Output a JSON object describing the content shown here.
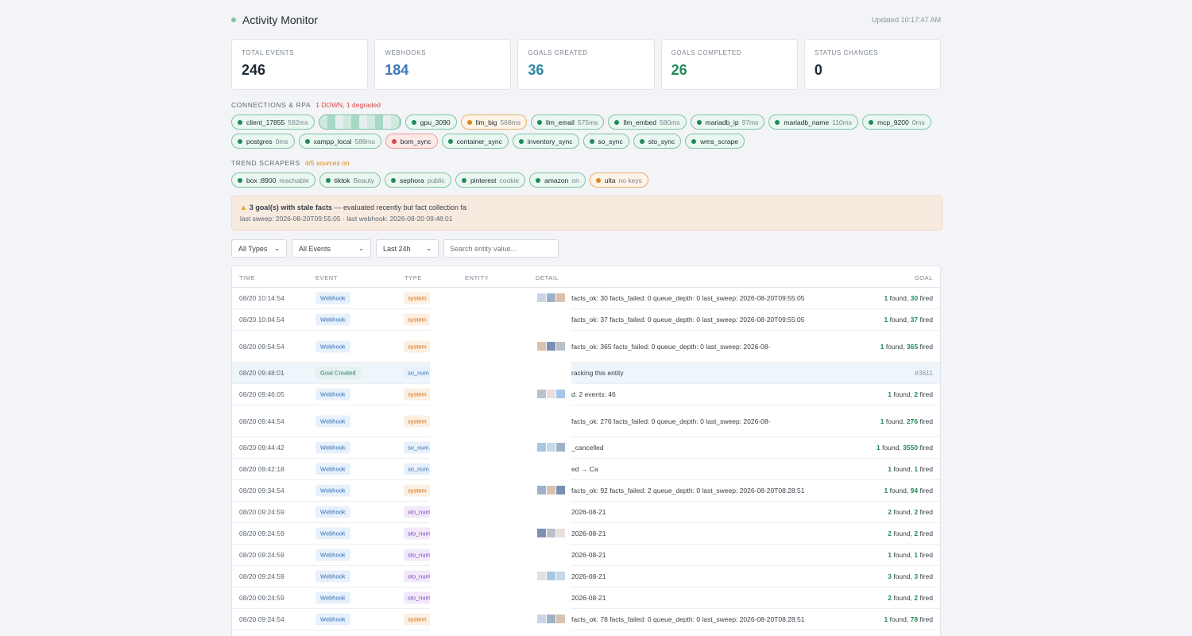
{
  "header": {
    "title": "Activity Monitor",
    "updated": "Updated 10:17:47 AM"
  },
  "stats": [
    {
      "label": "TOTAL EVENTS",
      "value": "246",
      "color": "#1f2933"
    },
    {
      "label": "WEBHOOKS",
      "value": "184",
      "color": "#3b79b8"
    },
    {
      "label": "GOALS CREATED",
      "value": "36",
      "color": "#2a86a3"
    },
    {
      "label": "GOALS COMPLETED",
      "value": "26",
      "color": "#1f8a5b"
    },
    {
      "label": "STATUS CHANGES",
      "value": "0",
      "color": "#1f2933"
    }
  ],
  "connections": {
    "title": "CONNECTIONS & RPA",
    "alert": "1 DOWN, 1 degraded",
    "row1": [
      {
        "name": "client_17855",
        "ms": "592ms",
        "state": "ok"
      },
      {
        "name": "",
        "ms": "",
        "state": "redacted"
      },
      {
        "name": "gpu_3090",
        "ms": "",
        "state": "ok"
      },
      {
        "name": "llm_big",
        "ms": "568ms",
        "state": "warn"
      },
      {
        "name": "llm_email",
        "ms": "575ms",
        "state": "ok"
      },
      {
        "name": "llm_embed",
        "ms": "580ms",
        "state": "ok"
      },
      {
        "name": "mariadb_ip",
        "ms": "97ms",
        "state": "ok"
      },
      {
        "name": "mariadb_name",
        "ms": "110ms",
        "state": "ok"
      },
      {
        "name": "mcp_9200",
        "ms": "0ms",
        "state": "ok"
      }
    ],
    "row2": [
      {
        "name": "postgres",
        "ms": "0ms",
        "state": "ok"
      },
      {
        "name": "xampp_local",
        "ms": "588ms",
        "state": "ok"
      },
      {
        "name": "bom_sync",
        "ms": "",
        "state": "down"
      },
      {
        "name": "container_sync",
        "ms": "",
        "state": "ok"
      },
      {
        "name": "inventory_sync",
        "ms": "",
        "state": "ok"
      },
      {
        "name": "so_sync",
        "ms": "",
        "state": "ok"
      },
      {
        "name": "sto_sync",
        "ms": "",
        "state": "ok"
      },
      {
        "name": "wms_scrape",
        "ms": "",
        "state": "ok"
      }
    ]
  },
  "scrapers": {
    "title": "TREND SCRAPERS",
    "status": "4/5 sources on",
    "items": [
      {
        "name": "box :8900",
        "note": "reachable",
        "state": "ok"
      },
      {
        "name": "tiktok",
        "note": "Beauty",
        "state": "ok"
      },
      {
        "name": "sephora",
        "note": "public",
        "state": "ok"
      },
      {
        "name": "pinterest",
        "note": "cookie",
        "state": "ok"
      },
      {
        "name": "amazon",
        "note": "on",
        "state": "ok"
      },
      {
        "name": "ulta",
        "note": "no keys",
        "state": "warn"
      }
    ]
  },
  "banner": {
    "strong": "3 goal(s) with stale facts",
    "text": " — evaluated recently but fact collection fa",
    "line2": "last sweep: 2026-08-20T09:55:05 · last webhook: 2026-08-20 09:48:01"
  },
  "filters": {
    "types": "All Types",
    "events": "All Events",
    "range": "Last 24h",
    "search_placeholder": "Search entity value..."
  },
  "table": {
    "headers": {
      "time": "TIME",
      "event": "EVENT",
      "type": "TYPE",
      "entity": "ENTITY",
      "detail": "DETAIL",
      "goal": "GOAL"
    },
    "rows": [
      {
        "time": "08/20 10:14:54",
        "event": "Webhook",
        "type": "system",
        "detail": "facts_ok: 30   facts_failed: 0   queue_depth: 0   last_sweep: 2026-08-20T09:55:05",
        "found": "1",
        "fired": "30"
      },
      {
        "time": "08/20 10:04:54",
        "event": "Webhook",
        "type": "system",
        "detail": "facts_ok: 37   facts_failed: 0   queue_depth: 0   last_sweep: 2026-08-20T09:55:05",
        "found": "1",
        "fired": "37"
      },
      {
        "time": "08/20 09:54:54",
        "event": "Webhook",
        "type": "system",
        "detail": "facts_ok: 365   facts_failed: 0   queue_depth: 0   last_sweep: 2026-08-",
        "found": "1",
        "fired": "365"
      },
      {
        "time": "08/20 09:48:01",
        "event": "Goal Created",
        "type": "so_num",
        "detail": "racking this entity",
        "goal_id": "#3611"
      },
      {
        "time": "08/20 09:46:05",
        "event": "Webhook",
        "type": "system",
        "detail": "d: 2   events: 46",
        "found": "1",
        "fired": "2"
      },
      {
        "time": "08/20 09:44:54",
        "event": "Webhook",
        "type": "system",
        "detail": "facts_ok: 276   facts_failed: 0   queue_depth: 0   last_sweep: 2026-08-",
        "found": "1",
        "fired": "276"
      },
      {
        "time": "08/20 09:44:42",
        "event": "Webhook",
        "type": "so_num",
        "detail": "_cancelled",
        "found": "1",
        "fired": "3550"
      },
      {
        "time": "08/20 09:42:18",
        "event": "Webhook",
        "type": "so_num",
        "detail": "ed → Ca",
        "found": "1",
        "fired": "1"
      },
      {
        "time": "08/20 09:34:54",
        "event": "Webhook",
        "type": "system",
        "detail": "facts_ok: 92   facts_failed: 2   queue_depth: 0   last_sweep: 2026-08-20T08:28:51",
        "found": "1",
        "fired": "94"
      },
      {
        "time": "08/20 09:24:59",
        "event": "Webhook",
        "type": "sto_num",
        "detail": "2026-08-21",
        "found": "2",
        "fired": "2"
      },
      {
        "time": "08/20 09:24:59",
        "event": "Webhook",
        "type": "sto_num",
        "detail": "2026-08-21",
        "found": "2",
        "fired": "2"
      },
      {
        "time": "08/20 09:24:59",
        "event": "Webhook",
        "type": "sto_num",
        "detail": "2026-08-21",
        "found": "1",
        "fired": "1"
      },
      {
        "time": "08/20 09:24:59",
        "event": "Webhook",
        "type": "sto_num",
        "detail": "2026-08-21",
        "found": "3",
        "fired": "3"
      },
      {
        "time": "08/20 09:24:59",
        "event": "Webhook",
        "type": "sto_num",
        "detail": "2026-08-21",
        "found": "2",
        "fired": "2"
      },
      {
        "time": "08/20 09:24:54",
        "event": "Webhook",
        "type": "system",
        "detail": "facts_ok: 78   facts_failed: 0   queue_depth: 0   last_sweep: 2026-08-20T08:28:51",
        "found": "1",
        "fired": "78"
      }
    ],
    "found_word": "found,",
    "fired_word": "fired"
  }
}
